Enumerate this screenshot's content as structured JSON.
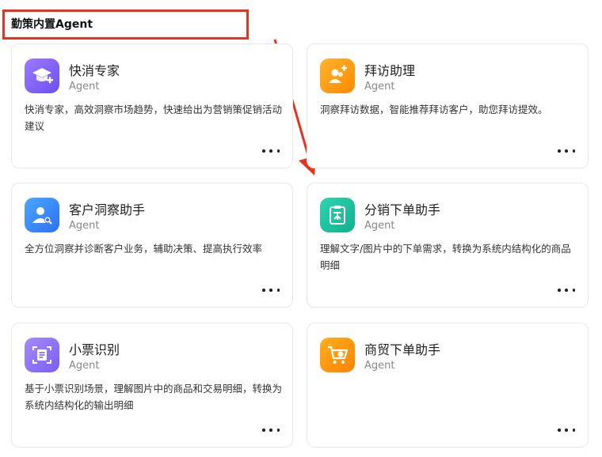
{
  "section": {
    "title": "勤策内置Agent"
  },
  "colors": {
    "annotation_red": "#e8321e"
  },
  "agents": [
    {
      "name": "快消专家",
      "type": "Agent",
      "description": "快消专家，高效洞察市场趋势，快速给出为营销策促销活动建议",
      "icon": "graduation-cap-plus-icon"
    },
    {
      "name": "拜访助理",
      "type": "Agent",
      "description": "洞察拜访数据，智能推荐拜访客户，助您拜访提效。",
      "icon": "people-plus-icon"
    },
    {
      "name": "客户洞察助手",
      "type": "Agent",
      "description": "全方位洞察并诊断客户业务，辅助决策、提高执行效率",
      "icon": "user-search-icon"
    },
    {
      "name": "分销下单助手",
      "type": "Agent",
      "description": "理解文字/图片中的下单需求，转换为系统内结构化的商品明细",
      "icon": "clipboard-hierarchy-icon"
    },
    {
      "name": "小票识别",
      "type": "Agent",
      "description": "基于小票识别场景，理解图片中的商品和交易明细，转换为系统内结构化的输出明细",
      "icon": "receipt-scan-icon"
    },
    {
      "name": "商贸下单助手",
      "type": "Agent",
      "description": "",
      "icon": "shopping-cart-icon"
    }
  ]
}
